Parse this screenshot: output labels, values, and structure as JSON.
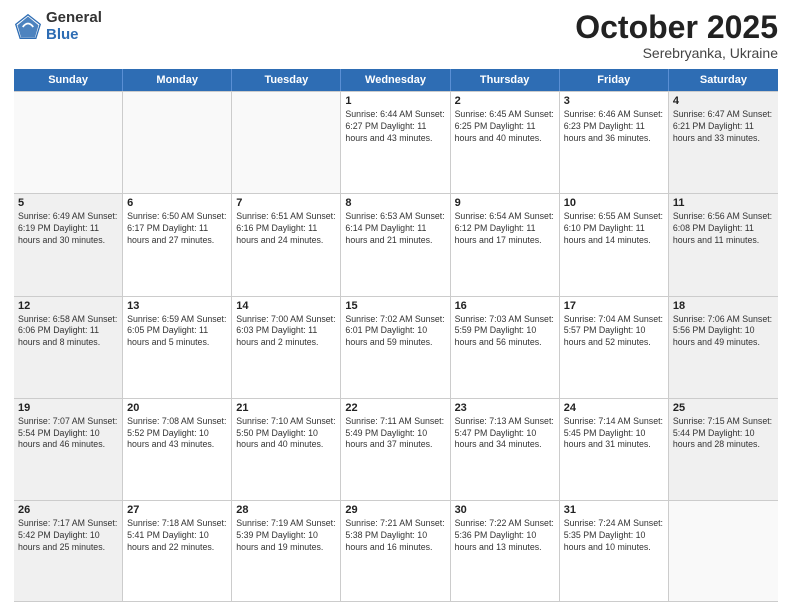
{
  "header": {
    "logo_general": "General",
    "logo_blue": "Blue",
    "month_title": "October 2025",
    "location": "Serebryanka, Ukraine"
  },
  "calendar": {
    "weekdays": [
      "Sunday",
      "Monday",
      "Tuesday",
      "Wednesday",
      "Thursday",
      "Friday",
      "Saturday"
    ],
    "rows": [
      [
        {
          "day": "",
          "info": "",
          "empty": true
        },
        {
          "day": "",
          "info": "",
          "empty": true
        },
        {
          "day": "",
          "info": "",
          "empty": true
        },
        {
          "day": "1",
          "info": "Sunrise: 6:44 AM\nSunset: 6:27 PM\nDaylight: 11 hours\nand 43 minutes."
        },
        {
          "day": "2",
          "info": "Sunrise: 6:45 AM\nSunset: 6:25 PM\nDaylight: 11 hours\nand 40 minutes."
        },
        {
          "day": "3",
          "info": "Sunrise: 6:46 AM\nSunset: 6:23 PM\nDaylight: 11 hours\nand 36 minutes."
        },
        {
          "day": "4",
          "info": "Sunrise: 6:47 AM\nSunset: 6:21 PM\nDaylight: 11 hours\nand 33 minutes.",
          "shaded": true
        }
      ],
      [
        {
          "day": "5",
          "info": "Sunrise: 6:49 AM\nSunset: 6:19 PM\nDaylight: 11 hours\nand 30 minutes.",
          "shaded": true
        },
        {
          "day": "6",
          "info": "Sunrise: 6:50 AM\nSunset: 6:17 PM\nDaylight: 11 hours\nand 27 minutes."
        },
        {
          "day": "7",
          "info": "Sunrise: 6:51 AM\nSunset: 6:16 PM\nDaylight: 11 hours\nand 24 minutes."
        },
        {
          "day": "8",
          "info": "Sunrise: 6:53 AM\nSunset: 6:14 PM\nDaylight: 11 hours\nand 21 minutes."
        },
        {
          "day": "9",
          "info": "Sunrise: 6:54 AM\nSunset: 6:12 PM\nDaylight: 11 hours\nand 17 minutes."
        },
        {
          "day": "10",
          "info": "Sunrise: 6:55 AM\nSunset: 6:10 PM\nDaylight: 11 hours\nand 14 minutes."
        },
        {
          "day": "11",
          "info": "Sunrise: 6:56 AM\nSunset: 6:08 PM\nDaylight: 11 hours\nand 11 minutes.",
          "shaded": true
        }
      ],
      [
        {
          "day": "12",
          "info": "Sunrise: 6:58 AM\nSunset: 6:06 PM\nDaylight: 11 hours\nand 8 minutes.",
          "shaded": true
        },
        {
          "day": "13",
          "info": "Sunrise: 6:59 AM\nSunset: 6:05 PM\nDaylight: 11 hours\nand 5 minutes."
        },
        {
          "day": "14",
          "info": "Sunrise: 7:00 AM\nSunset: 6:03 PM\nDaylight: 11 hours\nand 2 minutes."
        },
        {
          "day": "15",
          "info": "Sunrise: 7:02 AM\nSunset: 6:01 PM\nDaylight: 10 hours\nand 59 minutes."
        },
        {
          "day": "16",
          "info": "Sunrise: 7:03 AM\nSunset: 5:59 PM\nDaylight: 10 hours\nand 56 minutes."
        },
        {
          "day": "17",
          "info": "Sunrise: 7:04 AM\nSunset: 5:57 PM\nDaylight: 10 hours\nand 52 minutes."
        },
        {
          "day": "18",
          "info": "Sunrise: 7:06 AM\nSunset: 5:56 PM\nDaylight: 10 hours\nand 49 minutes.",
          "shaded": true
        }
      ],
      [
        {
          "day": "19",
          "info": "Sunrise: 7:07 AM\nSunset: 5:54 PM\nDaylight: 10 hours\nand 46 minutes.",
          "shaded": true
        },
        {
          "day": "20",
          "info": "Sunrise: 7:08 AM\nSunset: 5:52 PM\nDaylight: 10 hours\nand 43 minutes."
        },
        {
          "day": "21",
          "info": "Sunrise: 7:10 AM\nSunset: 5:50 PM\nDaylight: 10 hours\nand 40 minutes."
        },
        {
          "day": "22",
          "info": "Sunrise: 7:11 AM\nSunset: 5:49 PM\nDaylight: 10 hours\nand 37 minutes."
        },
        {
          "day": "23",
          "info": "Sunrise: 7:13 AM\nSunset: 5:47 PM\nDaylight: 10 hours\nand 34 minutes."
        },
        {
          "day": "24",
          "info": "Sunrise: 7:14 AM\nSunset: 5:45 PM\nDaylight: 10 hours\nand 31 minutes."
        },
        {
          "day": "25",
          "info": "Sunrise: 7:15 AM\nSunset: 5:44 PM\nDaylight: 10 hours\nand 28 minutes.",
          "shaded": true
        }
      ],
      [
        {
          "day": "26",
          "info": "Sunrise: 7:17 AM\nSunset: 5:42 PM\nDaylight: 10 hours\nand 25 minutes.",
          "shaded": true
        },
        {
          "day": "27",
          "info": "Sunrise: 7:18 AM\nSunset: 5:41 PM\nDaylight: 10 hours\nand 22 minutes."
        },
        {
          "day": "28",
          "info": "Sunrise: 7:19 AM\nSunset: 5:39 PM\nDaylight: 10 hours\nand 19 minutes."
        },
        {
          "day": "29",
          "info": "Sunrise: 7:21 AM\nSunset: 5:38 PM\nDaylight: 10 hours\nand 16 minutes."
        },
        {
          "day": "30",
          "info": "Sunrise: 7:22 AM\nSunset: 5:36 PM\nDaylight: 10 hours\nand 13 minutes."
        },
        {
          "day": "31",
          "info": "Sunrise: 7:24 AM\nSunset: 5:35 PM\nDaylight: 10 hours\nand 10 minutes."
        },
        {
          "day": "",
          "info": "",
          "empty": true
        }
      ]
    ]
  }
}
